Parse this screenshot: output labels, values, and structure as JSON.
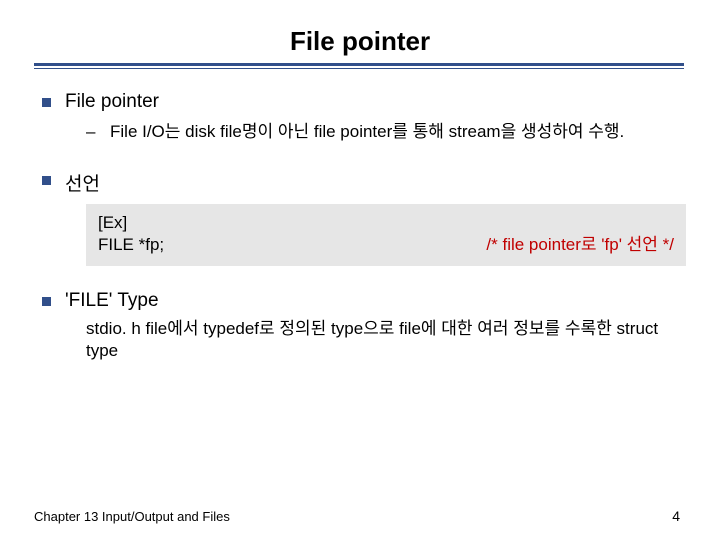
{
  "title": "File pointer",
  "sections": {
    "s1": {
      "head": "File pointer",
      "sub": "File I/O는 disk file명이 아닌 file pointer를 통해 stream을 생성하여 수행."
    },
    "s2": {
      "head": "선언",
      "code_line1": "[Ex]",
      "code_left": "FILE *fp;",
      "code_right": "/* file pointer로 'fp' 선언 */"
    },
    "s3": {
      "head": "'FILE' Type",
      "desc": "stdio. h file에서 typedef로 정의된 type으로 file에 대한 여러 정보를 수록한 struct type"
    }
  },
  "footer": {
    "left": "Chapter 13  Input/Output and Files",
    "page": "4"
  }
}
